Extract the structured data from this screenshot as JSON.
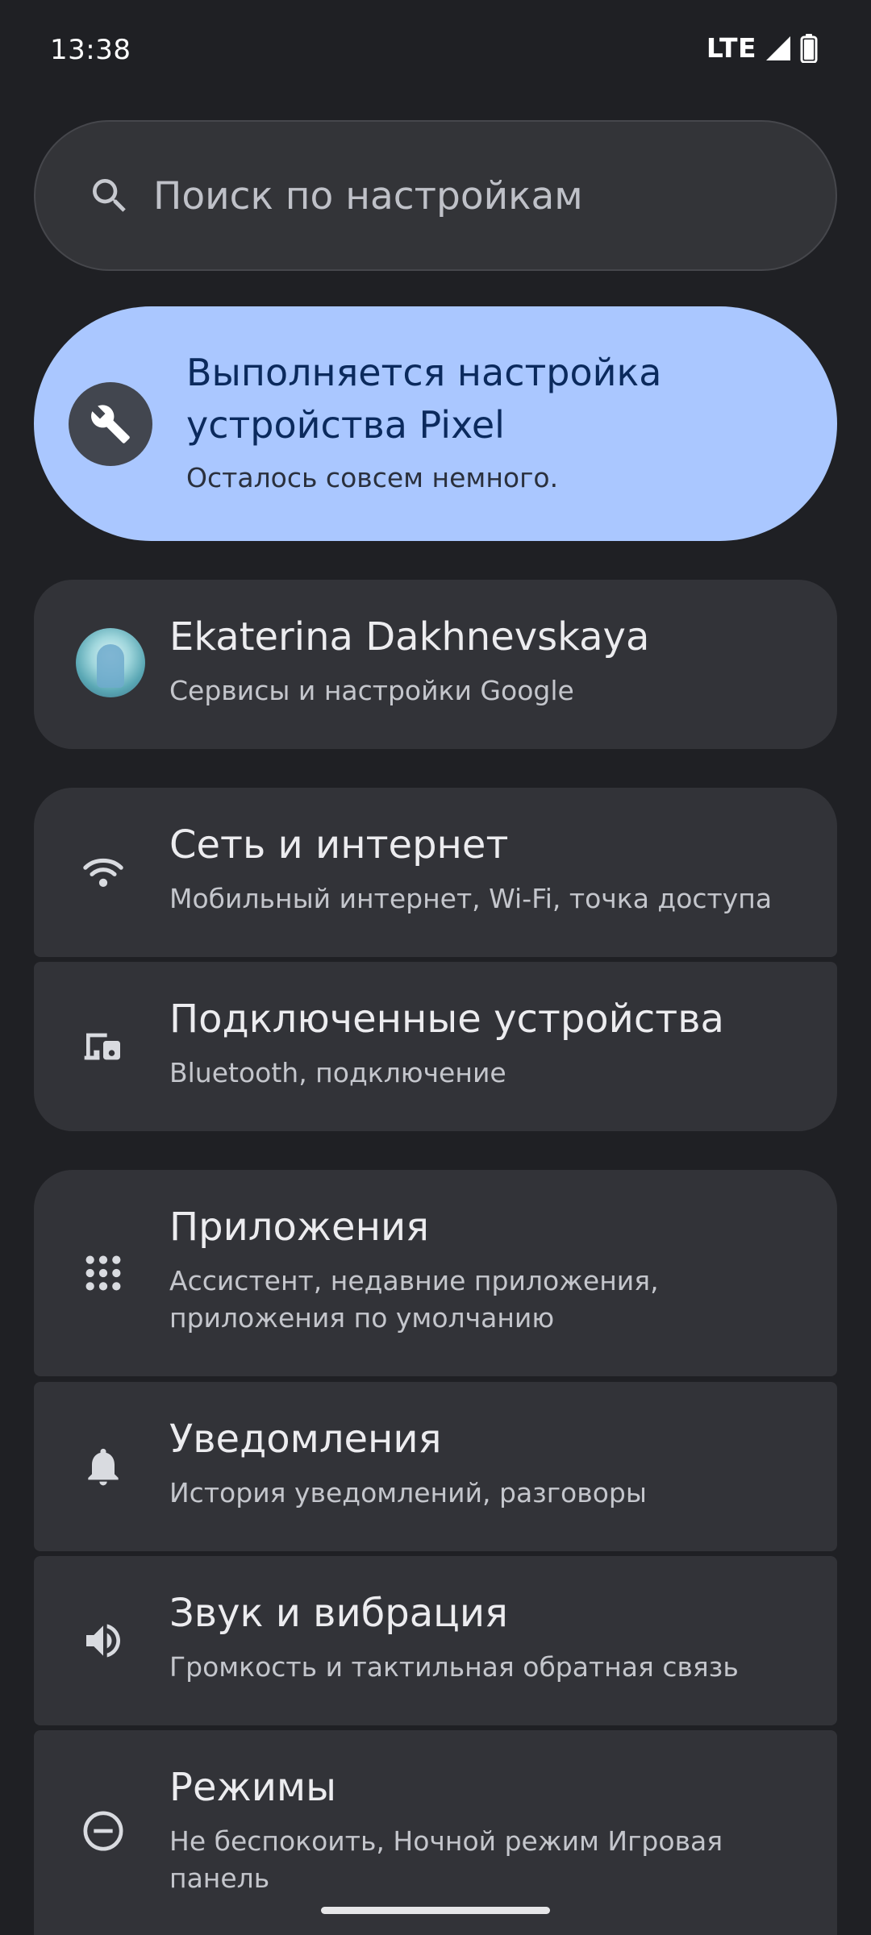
{
  "status_bar": {
    "time": "13:38",
    "network": "LTE",
    "signal_icon": "cell-signal-icon",
    "battery_icon": "battery-icon"
  },
  "search": {
    "placeholder": "Поиск по настройкам",
    "icon": "search-icon"
  },
  "setup_banner": {
    "icon": "wrench-icon",
    "title": "Выполняется настройка устройства Pixel",
    "subtitle": "Осталось совсем немного."
  },
  "account": {
    "name": "Ekaterina Dakhnevskaya",
    "subtitle": "Сервисы и настройки Google"
  },
  "settings": [
    {
      "icon": "wifi-icon",
      "title": "Сеть и интернет",
      "subtitle": "Мобильный интернет, Wi-Fi, точка доступа"
    },
    {
      "icon": "connected-devices-icon",
      "title": "Подключенные устройства",
      "subtitle": "Bluetooth, подключение"
    },
    {
      "icon": "apps-grid-icon",
      "title": "Приложения",
      "subtitle": "Ассистент, недавние приложения, приложения по умолчанию"
    },
    {
      "icon": "bell-icon",
      "title": "Уведомления",
      "subtitle": "История уведомлений, разговоры"
    },
    {
      "icon": "volume-icon",
      "title": "Звук и вибрация",
      "subtitle": "Громкость и тактильная обратная связь"
    },
    {
      "icon": "do-not-disturb-icon",
      "title": "Режимы",
      "subtitle": "Не беспокоить, Ночной режим Игровая панель"
    }
  ],
  "colors": {
    "background": "#1f2024",
    "card": "#323338",
    "banner": "#aac7ff",
    "banner_text": "#0b2a5d"
  }
}
